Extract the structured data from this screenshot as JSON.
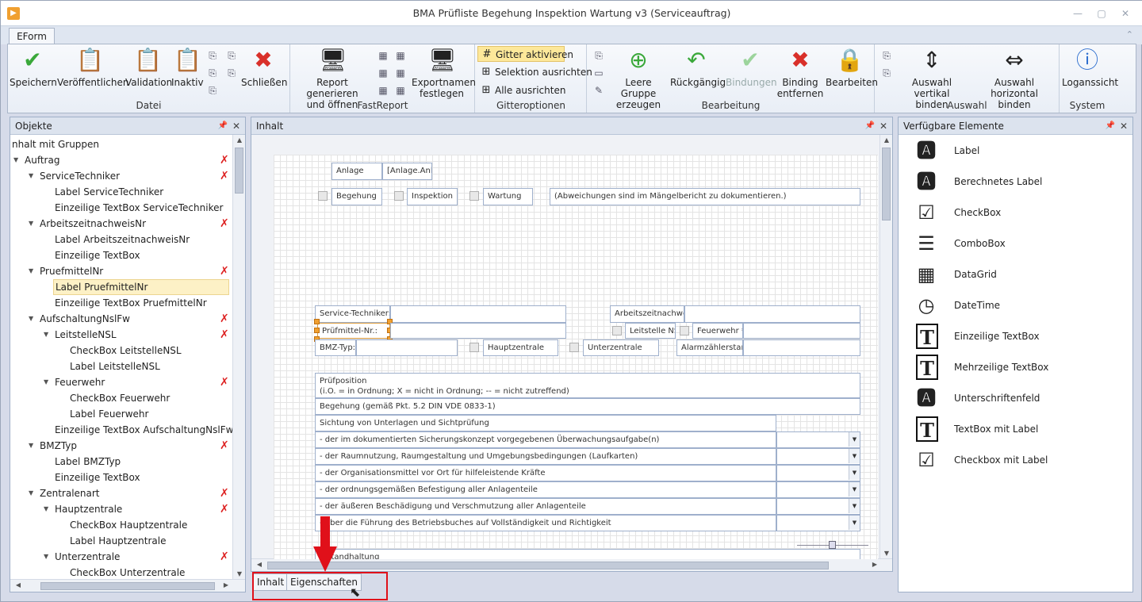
{
  "window": {
    "title": "BMA Prüfliste Begehung Inspektion Wartung v3 (Serviceauftrag)"
  },
  "ribbon_tab": "EForm",
  "ribbon": {
    "datei": {
      "label": "Datei",
      "speichern": "Speichern",
      "veroeffentlichen": "Veröffentlichen",
      "validation": "Validation",
      "inaktiv": "Inaktiv",
      "schliessen": "Schließen"
    },
    "fastreport": {
      "label": "FastReport",
      "report_line1": "Report generieren",
      "report_line2": "und öffnen",
      "export_line1": "Exportnamen",
      "export_line2": "festlegen"
    },
    "gitter": {
      "label": "Gitteroptionen",
      "aktivieren": "Gitter aktivieren",
      "selektion": "Selektion ausrichten",
      "alle": "Alle ausrichten"
    },
    "bearbeitung": {
      "label": "Bearbeitung",
      "leere1": "Leere Gruppe",
      "leere2": "erzeugen",
      "rueck": "Rückgängig",
      "bind": "Bindungen",
      "bentf1": "Binding",
      "bentf2": "entfernen",
      "bearb": "Bearbeiten"
    },
    "auswahl": {
      "label": "Auswahl",
      "vert1": "Auswahl vertikal",
      "vert2": "binden",
      "hor1": "Auswahl horizontal",
      "hor2": "binden"
    },
    "system": {
      "label": "System",
      "log": "Loganssicht"
    }
  },
  "objekte": {
    "title": "Objekte",
    "items": [
      "nhalt mit Gruppen",
      "Auftrag",
      "ServiceTechniker",
      "Label ServiceTechniker",
      "Einzeilige TextBox ServiceTechniker",
      "ArbeitszeitnachweisNr",
      "Label ArbeitszeitnachweisNr",
      "Einzeilige TextBox",
      "PruefmittelNr",
      "Label PruefmittelNr",
      "Einzeilige TextBox PruefmittelNr",
      "AufschaltungNslFw",
      "LeitstelleNSL",
      "CheckBox LeitstelleNSL",
      "Label LeitstelleNSL",
      "Feuerwehr",
      "CheckBox Feuerwehr",
      "Label Feuerwehr",
      "Einzeilige TextBox AufschaltungNslFw",
      "BMZTyp",
      "Label BMZTyp",
      "Einzeilige TextBox",
      "Zentralenart",
      "Hauptzentrale",
      "CheckBox Hauptzentrale",
      "Label Hauptzentrale",
      "Unterzentrale",
      "CheckBox Unterzentrale"
    ]
  },
  "inhalt": {
    "title": "Inhalt",
    "form": {
      "anlage": "Anlage",
      "anlage_val": "[Anlage.Anla",
      "begehung": "Begehung",
      "inspektion": "Inspektion",
      "wartung": "Wartung",
      "hinweis": "(Abweichungen sind im Mängelbericht zu dokumentieren.)",
      "techniker": "Service-Techniker:",
      "arbeitszeit": "Arbeitszeitnachweis",
      "pruefmittel": "Prüfmittel-Nr.:",
      "leitstelle": "Leitstelle NS",
      "feuerwehr": "Feuerwehr *",
      "bmz": "BMZ-Typ:",
      "hauptzentrale": "Hauptzentrale",
      "unterzentrale": "Unterzentrale",
      "alarm": "Alarmzählerstanc",
      "pruef1": "Prüfposition",
      "pruef2": "(i.O. = in Ordnung; X = nicht in Ordnung; -- = nicht zutreffend)",
      "begehung_pkt": "Begehung (gemäß Pkt. 5.2 DIN VDE 0833-1)",
      "sichtung": "Sichtung von Unterlagen und Sichtprüfung",
      "rows": [
        "- der im dokumentierten Sicherungskonzept vorgegebenen Überwachungsaufgabe(n)",
        "- der Raumnutzung, Raumgestaltung und Umgebungsbedingungen (Laufkarten)",
        "- der Organisationsmittel vor Ort für hilfeleistende Kräfte",
        "- der ordnungsgemäßen Befestigung aller Anlagenteile",
        "- der äußeren Beschädigung und Verschmutzung aller Anlagenteile",
        "- über die Führung des Betriebsbuches auf Vollständigkeit und Richtigkeit"
      ],
      "instandhaltung": "Instandhaltung"
    }
  },
  "elemente": {
    "title": "Verfügbare Elemente",
    "items": [
      {
        "label": "Label",
        "icon": "label-icon"
      },
      {
        "label": "Berechnetes Label",
        "icon": "computed-label-icon"
      },
      {
        "label": "CheckBox",
        "icon": "checkbox-icon"
      },
      {
        "label": "ComboBox",
        "icon": "combobox-icon"
      },
      {
        "label": "DataGrid",
        "icon": "datagrid-icon"
      },
      {
        "label": "DateTime",
        "icon": "datetime-icon"
      },
      {
        "label": "Einzeilige TextBox",
        "icon": "textbox-icon"
      },
      {
        "label": "Mehrzeilige TextBox",
        "icon": "multiline-textbox-icon"
      },
      {
        "label": "Unterschriftenfeld",
        "icon": "signature-icon"
      },
      {
        "label": "TextBox mit Label",
        "icon": "textbox-label-icon"
      },
      {
        "label": "Checkbox mit Label",
        "icon": "checkbox-label-icon"
      }
    ]
  },
  "bottom_tabs": {
    "inhalt": "Inhalt",
    "eigenschaften": "Eigenschaften"
  },
  "colors": {
    "accent_highlight": "#e0101a",
    "selection_handle": "#f0a030"
  }
}
